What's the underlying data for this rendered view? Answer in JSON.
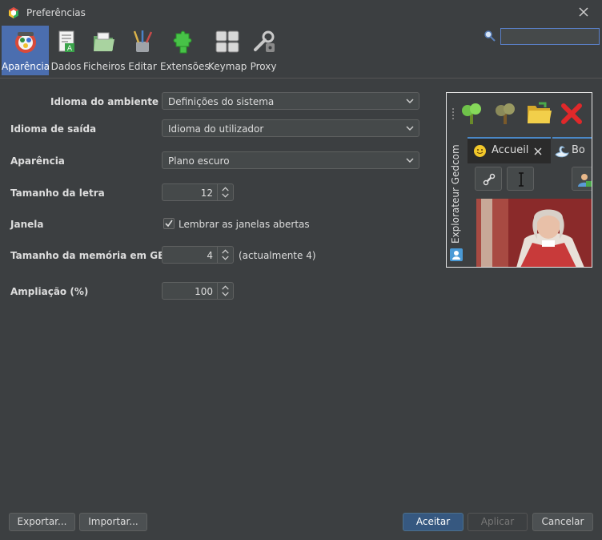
{
  "window": {
    "title": "Preferências"
  },
  "toolbar": {
    "items": [
      {
        "label": "Aparência",
        "icon": "appearance-icon"
      },
      {
        "label": "Dados",
        "icon": "data-icon"
      },
      {
        "label": "Ficheiros",
        "icon": "folders-icon"
      },
      {
        "label": "Editar",
        "icon": "edit-tools-icon"
      },
      {
        "label": "Extensões",
        "icon": "puzzle-icon"
      },
      {
        "label": "Keymap",
        "icon": "keyboard-icon"
      },
      {
        "label": "Proxy",
        "icon": "proxy-icon"
      }
    ],
    "active_index": 0
  },
  "search": {
    "value": "",
    "placeholder": ""
  },
  "form": {
    "env_language": {
      "label": "Idioma do ambiente",
      "value": "Definições do sistema"
    },
    "output_language": {
      "label": "Idioma de saída",
      "value": "Idioma do utilizador"
    },
    "look": {
      "label": "Aparência",
      "value": "Plano escuro"
    },
    "font_size": {
      "label": "Tamanho da letra",
      "value": "12"
    },
    "window": {
      "label": "Janela",
      "checkbox_label": "Lembrar as janelas abertas",
      "checked": true
    },
    "memory": {
      "label": "Tamanho da memória em GB",
      "value": "4",
      "note": "(actualmente 4)"
    },
    "zoom": {
      "label": "Ampliação (%)",
      "value": "100"
    }
  },
  "preview": {
    "side_label": "Explorateur Gedcom",
    "tab1": "Accueil",
    "tab2": "Bo"
  },
  "buttons": {
    "export": "Exportar...",
    "import": "Importar...",
    "accept": "Aceitar",
    "apply": "Aplicar",
    "cancel": "Cancelar"
  },
  "colors": {
    "background": "#3c3f41",
    "accent": "#4b6eaf",
    "primary_button": "#365880"
  }
}
